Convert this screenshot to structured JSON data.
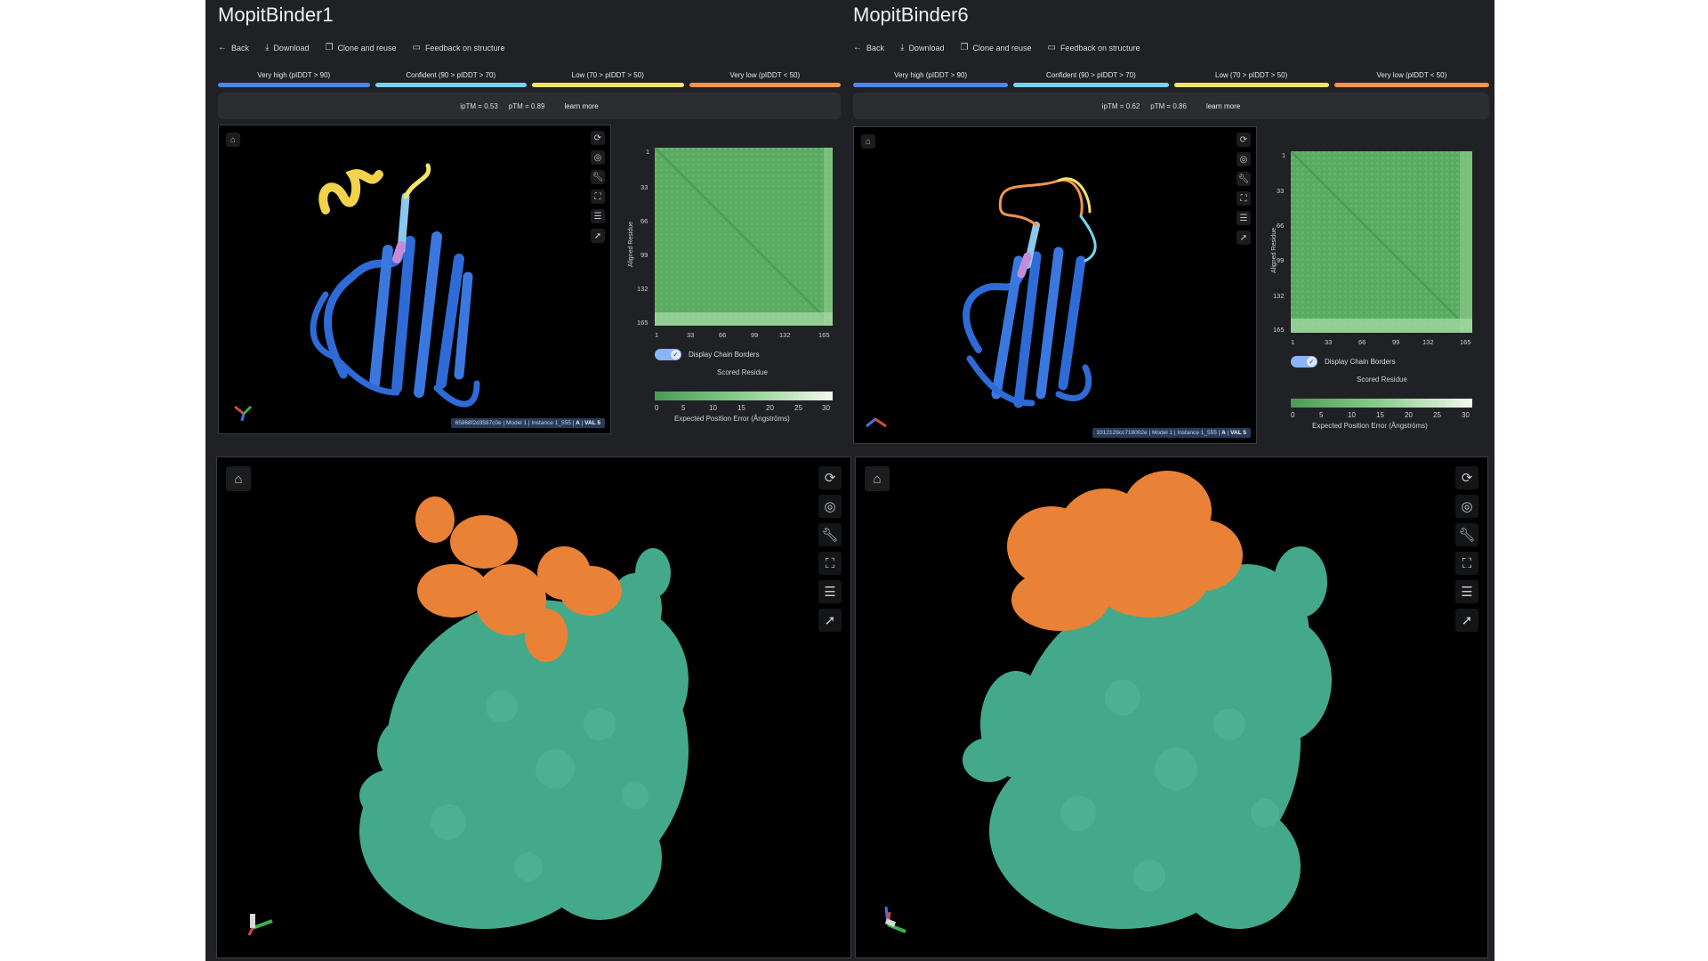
{
  "panels": [
    {
      "title": "MopitBinder1",
      "toolbar": {
        "back": "Back",
        "download": "Download",
        "clone": "Clone and reuse",
        "feedback": "Feedback on structure"
      },
      "legend": [
        {
          "label": "Very high (pIDDT > 90)",
          "color": "#4f86e8"
        },
        {
          "label": "Confident (90 > pIDDT > 70)",
          "color": "#78d3ef"
        },
        {
          "label": "Low (70 > pIDDT > 50)",
          "color": "#f3e36a"
        },
        {
          "label": "Very low (pIDDT < 50)",
          "color": "#f29550"
        }
      ],
      "metrics": {
        "iptm": "ipTM = 0.53",
        "ptm": "pTM = 0.89",
        "learn_more": "learn more"
      },
      "viewer_info": {
        "id": "65968f2d3587c0e",
        "model": "Model 1",
        "instance": "Instance 1_555",
        "chain": "A",
        "residue": "VAL 5"
      },
      "pae": {
        "ylabel": "Aligned Residue",
        "ticks": [
          "1",
          "33",
          "66",
          "99",
          "132",
          "165"
        ],
        "toggle_label": "Display Chain Borders",
        "xlabel": "Scored Residue",
        "cbar_ticks": [
          "0",
          "5",
          "10",
          "15",
          "20",
          "25",
          "30"
        ],
        "cbar_label": "Expected Position Error (Ångströms)"
      },
      "surface": {
        "binder_color": "#e98236",
        "target_color": "#43a98a"
      }
    },
    {
      "title": "MopitBinder6",
      "toolbar": {
        "back": "Back",
        "download": "Download",
        "clone": "Clone and reuse",
        "feedback": "Feedback on structure"
      },
      "legend": [
        {
          "label": "Very high (pIDDT > 90)",
          "color": "#4f86e8"
        },
        {
          "label": "Confident (90 > pIDDT > 70)",
          "color": "#78d3ef"
        },
        {
          "label": "Low (70 > pIDDT > 50)",
          "color": "#f3e36a"
        },
        {
          "label": "Very low (pIDDT < 50)",
          "color": "#f29550"
        }
      ],
      "metrics": {
        "iptm": "ipTM = 0.62",
        "ptm": "pTM = 0.86",
        "learn_more": "learn more"
      },
      "viewer_info": {
        "id": "3312129cc718002e",
        "model": "Model 1",
        "instance": "Instance 1_555",
        "chain": "A",
        "residue": "VAL 5"
      },
      "pae": {
        "ylabel": "Aligned Residue",
        "ticks": [
          "1",
          "33",
          "66",
          "99",
          "132",
          "165"
        ],
        "toggle_label": "Display Chain Borders",
        "xlabel": "Scored Residue",
        "cbar_ticks": [
          "0",
          "5",
          "10",
          "15",
          "20",
          "25",
          "30"
        ],
        "cbar_label": "Expected Position Error (Ångströms)"
      },
      "surface": {
        "binder_color": "#e98236",
        "target_color": "#43a98a"
      }
    }
  ],
  "icons": {
    "back": "arrow-left-icon",
    "download": "download-icon",
    "clone": "copy-icon",
    "feedback": "feedback-icon",
    "viewer_tools": [
      "rotate-icon",
      "focus-icon",
      "wrench-icon",
      "fullscreen-icon",
      "settings-sliders-icon",
      "pointer-icon"
    ],
    "lock": "lock-icon"
  }
}
